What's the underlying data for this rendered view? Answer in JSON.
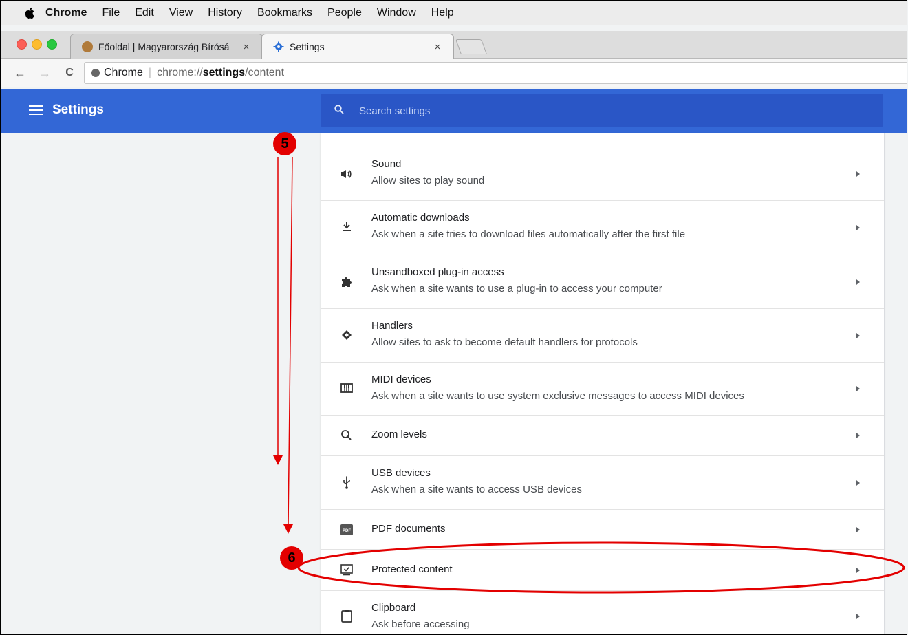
{
  "menubar": {
    "items": [
      "Chrome",
      "File",
      "Edit",
      "View",
      "History",
      "Bookmarks",
      "People",
      "Window",
      "Help"
    ]
  },
  "tabs": [
    {
      "title": "Főoldal | Magyarország Bírósá",
      "close": "×"
    },
    {
      "title": "Settings",
      "close": "×"
    }
  ],
  "toolbar": {
    "back": "←",
    "forward": "→",
    "reload": "C"
  },
  "omnibox": {
    "site_label": "Chrome",
    "url_prefix": "chrome://",
    "url_host": "settings",
    "url_path": "/content"
  },
  "header": {
    "title": "Settings",
    "search_placeholder": "Search settings"
  },
  "rows": [
    {
      "title": "Sound",
      "subtitle": "Allow sites to play sound",
      "icon": "speaker-icon"
    },
    {
      "title": "Automatic downloads",
      "subtitle": "Ask when a site tries to download files automatically after the first file",
      "icon": "download-icon"
    },
    {
      "title": "Unsandboxed plug-in access",
      "subtitle": "Ask when a site wants to use a plug-in to access your computer",
      "icon": "puzzle-icon"
    },
    {
      "title": "Handlers",
      "subtitle": "Allow sites to ask to become default handlers for protocols",
      "icon": "handler-icon"
    },
    {
      "title": "MIDI devices",
      "subtitle": "Ask when a site wants to use system exclusive messages to access MIDI devices",
      "icon": "piano-icon"
    },
    {
      "title": "Zoom levels",
      "subtitle": "",
      "icon": "zoom-icon"
    },
    {
      "title": "USB devices",
      "subtitle": "Ask when a site wants to access USB devices",
      "icon": "usb-icon"
    },
    {
      "title": "PDF documents",
      "subtitle": "",
      "icon": "pdf-icon"
    },
    {
      "title": "Protected content",
      "subtitle": "",
      "icon": "protected-content-icon"
    },
    {
      "title": "Clipboard",
      "subtitle": "Ask before accessing",
      "icon": "clipboard-icon"
    }
  ],
  "annotations": {
    "step5": "5",
    "step6": "6",
    "color": "#e30000"
  },
  "colors": {
    "header_blue": "#3367d6",
    "search_blue": "#2a56c6"
  }
}
